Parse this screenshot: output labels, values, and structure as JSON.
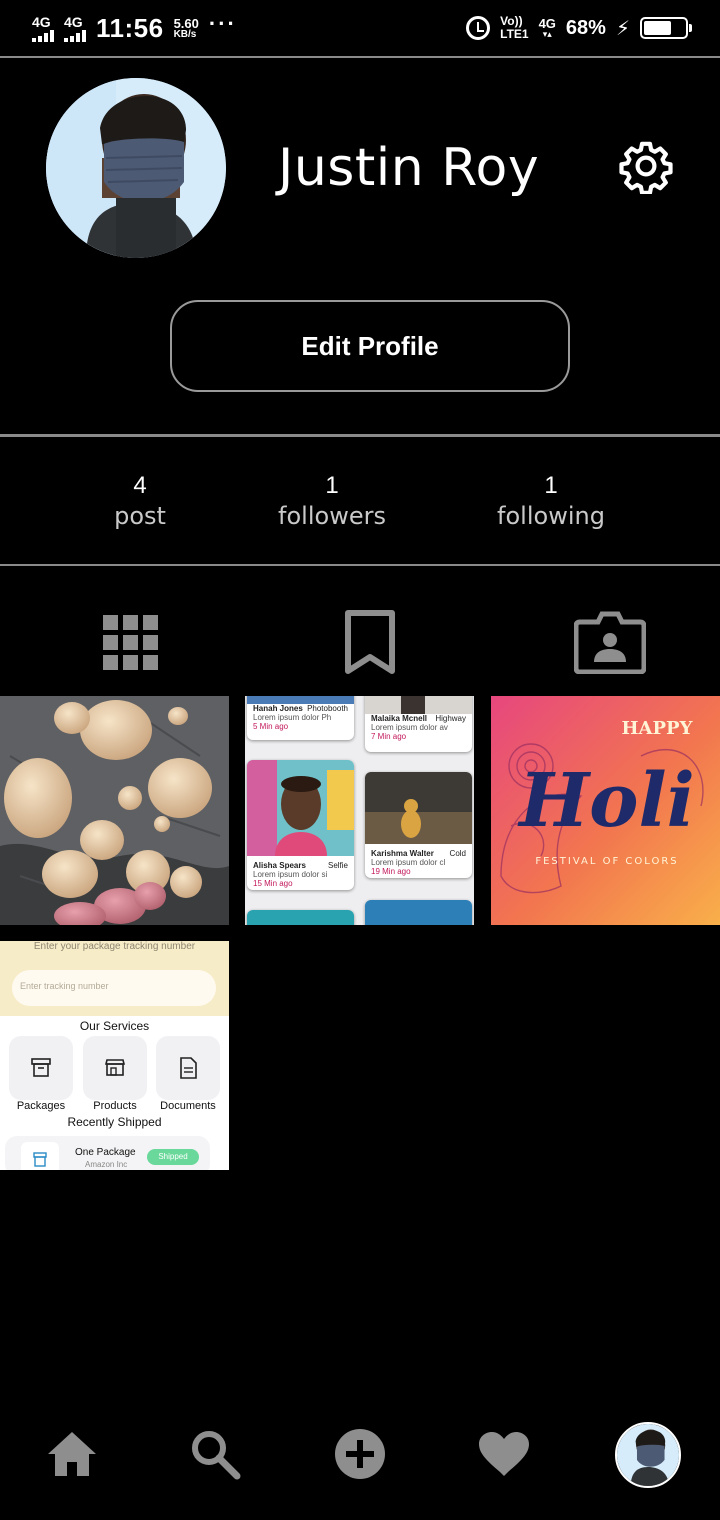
{
  "status_bar": {
    "sim1": "4G",
    "sim2": "4G",
    "time": "11:56",
    "speed_value": "5.60",
    "speed_unit": "KB/s",
    "more": "···",
    "volte_top": "Vo))",
    "volte_bottom": "LTE1",
    "network": "4G",
    "battery_percent": "68%",
    "battery_level": 0.68
  },
  "profile": {
    "name": "Justin Roy",
    "edit_button": "Edit Profile"
  },
  "stats": [
    {
      "value": "4",
      "label": "post"
    },
    {
      "value": "1",
      "label": "followers"
    },
    {
      "value": "1",
      "label": "following"
    }
  ],
  "tabs": [
    "grid-icon",
    "bookmark-icon",
    "tagged-photos-icon"
  ],
  "posts": {
    "tile2": {
      "cards": [
        {
          "name": "Hanah Jones",
          "tag": "Photobooth",
          "text": "Lorem ipsum dolor Ph",
          "time": "5 Min ago"
        },
        {
          "name": "Malaika Mcnell",
          "tag": "Highway",
          "text": "Lorem ipsum dolor av",
          "time": "7 Min ago"
        },
        {
          "name": "Alisha Spears",
          "tag": "Selfie",
          "text": "Lorem ipsum dolor si",
          "time": "15 Min ago"
        },
        {
          "name": "Karishma Walter",
          "tag": "Cold",
          "text": "Lorem ipsum dolor cl",
          "time": "19 Min ago"
        }
      ]
    },
    "tile3": {
      "happy": "HAPPY",
      "holi": "Holi",
      "festival": "FESTIVAL OF COLORS"
    },
    "tile4": {
      "prompt": "Enter your package tracking number",
      "placeholder": "Enter tracking number",
      "services_title": "Our Services",
      "services": [
        "Packages",
        "Products",
        "Documents"
      ],
      "recent_title": "Recently Shipped",
      "package_name": "One Package",
      "package_sub": "Amazon Inc",
      "badge": "Shipped"
    }
  },
  "bottom_nav": [
    "home-icon",
    "search-icon",
    "add-icon",
    "heart-icon",
    "profile-avatar"
  ]
}
